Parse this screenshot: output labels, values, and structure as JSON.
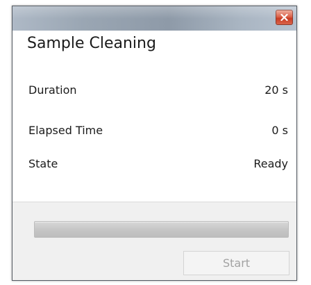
{
  "window": {
    "close_icon": "close-icon",
    "accent_close": "#d8553b"
  },
  "content": {
    "title": "Sample Cleaning",
    "rows": [
      {
        "label": "Duration",
        "value": "20 s"
      },
      {
        "label": "Elapsed Time",
        "value": "0 s"
      },
      {
        "label": "State",
        "value": "Ready"
      }
    ]
  },
  "footer": {
    "progress": 0,
    "start_label": "Start",
    "start_enabled": false
  }
}
